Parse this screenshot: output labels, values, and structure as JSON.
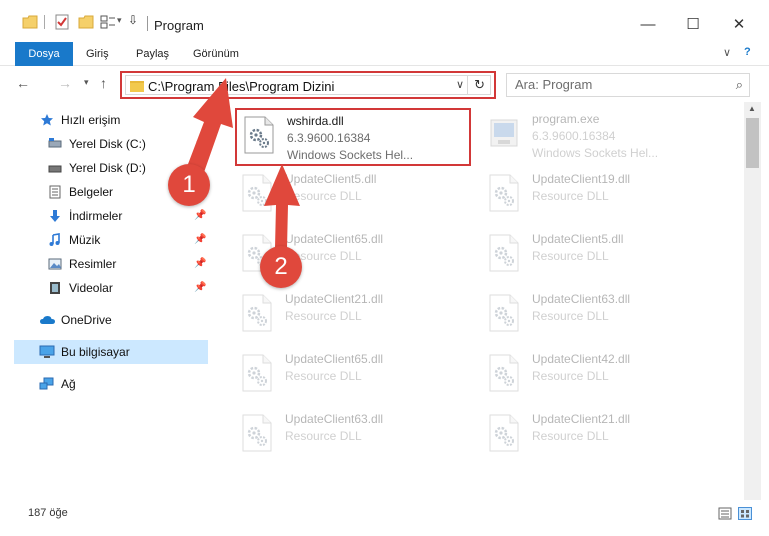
{
  "window": {
    "title": "Program",
    "controls": {
      "minimize": "—",
      "maximize": "☐",
      "close": "✕"
    }
  },
  "ribbon": {
    "tabs": [
      "Dosya",
      "Giriş",
      "Paylaş",
      "Görünüm"
    ]
  },
  "address": {
    "path": "C:\\Program Files\\Program Dizini"
  },
  "search": {
    "placeholder": "Ara: Program"
  },
  "sidebar": {
    "items": [
      {
        "label": "Hızlı erişim",
        "icon": "star-icon"
      },
      {
        "label": "Yerel Disk (C:)",
        "icon": "drive-icon",
        "pinned": true
      },
      {
        "label": "Yerel Disk (D:)",
        "icon": "drive-icon",
        "pinned": true
      },
      {
        "label": "Belgeler",
        "icon": "documents-icon",
        "pinned": true
      },
      {
        "label": "İndirmeler",
        "icon": "download-icon",
        "pinned": true
      },
      {
        "label": "Müzik",
        "icon": "music-icon",
        "pinned": true
      },
      {
        "label": "Resimler",
        "icon": "pictures-icon",
        "pinned": true
      },
      {
        "label": "Videolar",
        "icon": "video-icon",
        "pinned": true
      },
      {
        "label": "OneDrive",
        "icon": "cloud-icon"
      },
      {
        "label": "Bu bilgisayar",
        "icon": "computer-icon",
        "selected": true
      },
      {
        "label": "Ağ",
        "icon": "network-icon"
      }
    ]
  },
  "files": [
    {
      "name": "wshirda.dll",
      "version": "6.3.9600.16384",
      "desc": "Windows Sockets Hel...",
      "highlight": true
    },
    {
      "name": "program.exe",
      "version": "6.3.9600.16384",
      "desc": "Windows Sockets Hel...",
      "faded": true
    },
    {
      "name": "UpdateClient5.dll",
      "version": "Resource DLL",
      "faded": true
    },
    {
      "name": "UpdateClient19.dll",
      "version": "Resource DLL",
      "faded": true
    },
    {
      "name": "UpdateClient65.dll",
      "version": "Resource DLL",
      "faded": true
    },
    {
      "name": "UpdateClient5.dll",
      "version": "Resource DLL",
      "faded": true
    },
    {
      "name": "UpdateClient21.dll",
      "version": "Resource DLL",
      "faded": true
    },
    {
      "name": "UpdateClient63.dll",
      "version": "Resource DLL",
      "faded": true
    },
    {
      "name": "UpdateClient65.dll",
      "version": "Resource DLL",
      "faded": true
    },
    {
      "name": "UpdateClient42.dll",
      "version": "Resource DLL",
      "faded": true
    },
    {
      "name": "UpdateClient63.dll",
      "version": "Resource DLL",
      "faded": true
    },
    {
      "name": "UpdateClient21.dll",
      "version": "Resource DLL",
      "faded": true
    }
  ],
  "status": {
    "count": "187 öğe"
  },
  "annotations": {
    "step1": "1",
    "step2": "2"
  },
  "colors": {
    "accent": "#1979ca",
    "highlight_border": "#d23838",
    "callout": "#e0483c",
    "selected_bg": "#cce8ff"
  }
}
